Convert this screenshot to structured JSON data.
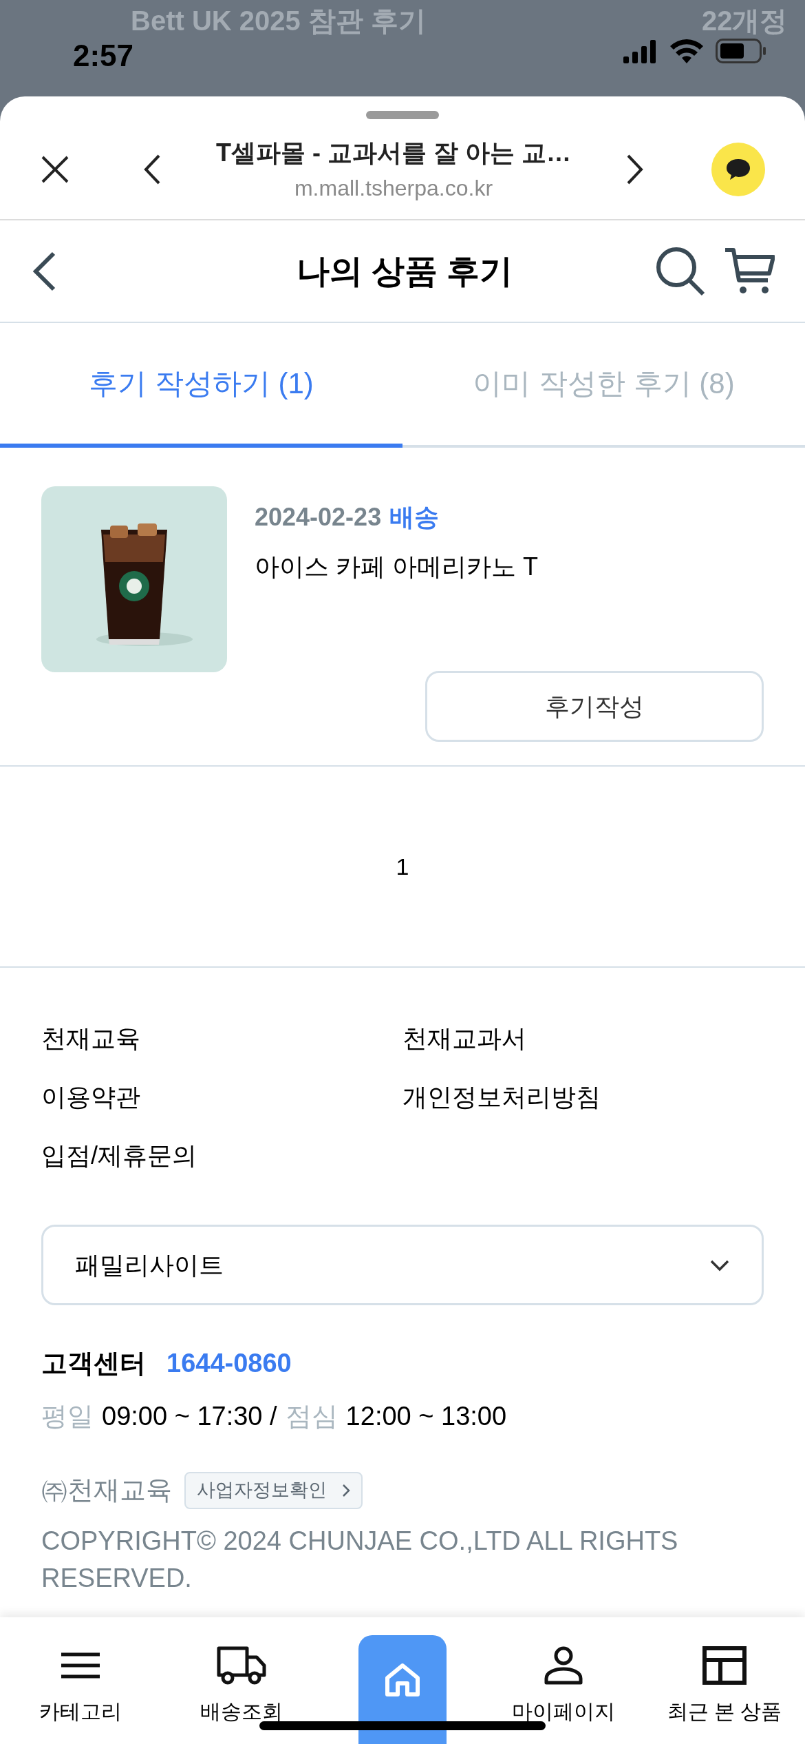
{
  "background_page": {
    "texts": [
      "Bett UK 2025 참관 후기",
      "22개정"
    ]
  },
  "status_bar": {
    "time": "2:57"
  },
  "browser_bar": {
    "title": "T셀파몰 - 교과서를 잘 아는 교…",
    "url": "m.mall.tsherpa.co.kr"
  },
  "header": {
    "title": "나의 상품 후기"
  },
  "tabs": [
    {
      "label": "후기 작성하기",
      "count": "(1)",
      "selected": true
    },
    {
      "label": "이미 작성한 후기",
      "count": "(8)",
      "selected": false
    }
  ],
  "products": [
    {
      "date": "2024-02-23",
      "status": "배송",
      "name": "아이스 카페 아메리카노 T",
      "button": "후기작성"
    }
  ],
  "pagination": [
    {
      "label": "1",
      "selected": true
    }
  ],
  "footer": {
    "links": [
      "천재교육",
      "천재교과서",
      "이용약관",
      "개인정보처리방침",
      "입점/제휴문의"
    ],
    "family_select": {
      "value": "패밀리사이트"
    },
    "customer_center": {
      "label": "고객센터",
      "phone": "1644-0860"
    },
    "hours": [
      {
        "label": "평일",
        "value": "09:00 ~ 17:30 /"
      },
      {
        "label": "점심",
        "value": "12:00 ~ 13:00"
      }
    ],
    "company": "㈜천재교육",
    "business_info_button": "사업자정보확인",
    "copyright": "COPYRIGHT© 2024 CHUNJAE CO.,LTD ALL RIGHTS RESERVED."
  },
  "bottom_nav": [
    {
      "kind": "menu",
      "label": "카테고리"
    },
    {
      "kind": "truck",
      "label": "배송조회"
    },
    {
      "kind": "home"
    },
    {
      "kind": "person",
      "label": "마이페이지"
    },
    {
      "kind": "recent",
      "label": "최근 본 상품"
    }
  ]
}
